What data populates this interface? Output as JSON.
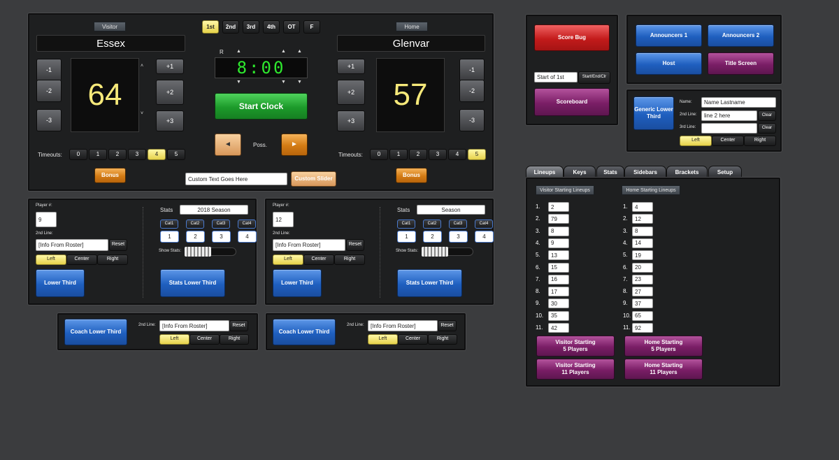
{
  "scoreboard": {
    "visitor_tag": "Visitor",
    "home_tag": "Home",
    "visitor_name": "Essex",
    "home_name": "Glenvar",
    "visitor_score": "64",
    "home_score": "57",
    "periods": [
      "1st",
      "2nd",
      "3rd",
      "4th",
      "OT",
      "F"
    ],
    "active_period": "1st",
    "clock": "8:00",
    "clock_reset": "R",
    "start_clock": "Start Clock",
    "poss": "Poss.",
    "minus_buttons": [
      "-1",
      "-2",
      "-3"
    ],
    "plus_buttons": [
      "+1",
      "+2",
      "+3"
    ],
    "timeouts_label": "Timeouts:",
    "timeouts": [
      "0",
      "1",
      "2",
      "3",
      "4",
      "5"
    ],
    "visitor_timeouts_active": "4",
    "home_timeouts_active": "5",
    "bonus": "Bonus",
    "custom_text": "Custom Text Goes Here",
    "custom_slider": "Custom Slider",
    "left_arrow": "◄",
    "right_arrow": "►"
  },
  "player_panels": [
    {
      "player_label": "Player #:",
      "player_num": "9",
      "second_line_label": "2nd Line:",
      "second_line": "[Info From Roster]",
      "reset": "Reset",
      "align": [
        "Left",
        "Center",
        "Right"
      ],
      "lower_third": "Lower Third",
      "stats_label": "Stats",
      "stats_season": "2018 Season",
      "cats": [
        "Cat1",
        "Cat2",
        "Cat3",
        "Cat4"
      ],
      "cat_nums": [
        "1",
        "2",
        "3",
        "4"
      ],
      "show_stats": "Show Stats:",
      "stats_lower_third": "Stats Lower Third"
    },
    {
      "player_label": "Player #:",
      "player_num": "12",
      "second_line_label": "2nd Line:",
      "second_line": "[Info From Roster]",
      "reset": "Reset",
      "align": [
        "Left",
        "Center",
        "Right"
      ],
      "lower_third": "Lower Third",
      "stats_label": "Stats",
      "stats_season": "Season",
      "cats": [
        "Cat1",
        "Cat2",
        "Cat3",
        "Cat4"
      ],
      "cat_nums": [
        "1",
        "2",
        "3",
        "4"
      ],
      "show_stats": "Show Stats:",
      "stats_lower_third": "Stats Lower Third"
    }
  ],
  "coach_panels": [
    {
      "button": "Coach Lower Third",
      "second_line_label": "2nd Line:",
      "second_line": "[Info From Roster]",
      "reset": "Reset",
      "align": [
        "Left",
        "Center",
        "Right"
      ]
    },
    {
      "button": "Coach Lower Third",
      "second_line_label": "2nd Line:",
      "second_line": "[Info From Roster]",
      "reset": "Reset",
      "align": [
        "Left",
        "Center",
        "Right"
      ]
    }
  ],
  "bug_panel": {
    "score_bug": "Score Bug",
    "period_text": "Start of 1st",
    "start_end": "Start/End/Clr",
    "scoreboard": "Scoreboard"
  },
  "announcer_panel": {
    "announcers1": "Announcers 1",
    "announcers2": "Announcers 2",
    "host": "Host",
    "title_screen": "Title Screen"
  },
  "generic_panel": {
    "button": "Generic Lower Third",
    "name_label": "Name:",
    "name_value": "Name Lastname",
    "line2_label": "2nd Line:",
    "line2_value": "line 2 here",
    "line3_label": "3rd Line:",
    "line3_value": "",
    "clear": "Clear",
    "align": [
      "Left",
      "Center",
      "Right"
    ]
  },
  "tabs": [
    "Lineups",
    "Keys",
    "Stats",
    "Sidebars",
    "Brackets",
    "Setup"
  ],
  "lineups": {
    "visitor_header": "Visitor Starting Lineups",
    "home_header": "Home Starting Lineups",
    "numbers": [
      "1.",
      "2.",
      "3.",
      "4.",
      "5.",
      "6.",
      "7.",
      "8.",
      "9.",
      "10.",
      "11."
    ],
    "visitor": [
      "2",
      "79",
      "8",
      "9",
      "13",
      "15",
      "16",
      "17",
      "30",
      "35",
      "42"
    ],
    "home": [
      "4",
      "12",
      "8",
      "14",
      "19",
      "20",
      "23",
      "27",
      "37",
      "65",
      "92"
    ],
    "visitor5": "Visitor Starting\n5 Players",
    "home5": "Home Starting\n5 Players",
    "visitor11": "Visitor Starting\n11 Players",
    "home11": "Home Starting\n11 Players"
  }
}
